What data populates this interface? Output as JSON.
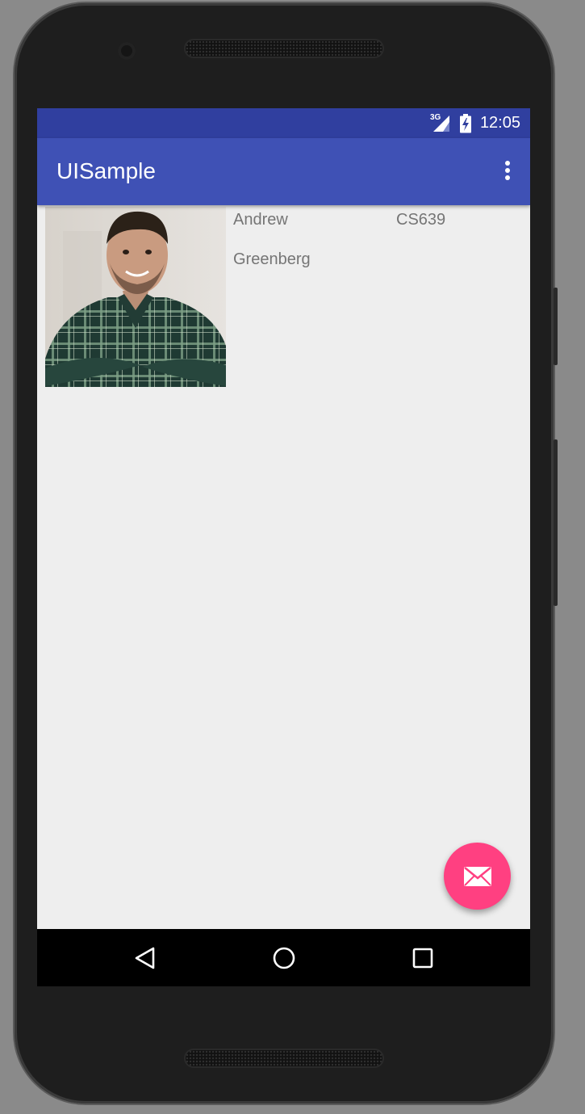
{
  "status_bar": {
    "network": "3G",
    "time": "12:05",
    "icons": [
      "signal-icon",
      "battery-charging-icon"
    ]
  },
  "app_bar": {
    "title": "UISample",
    "menu_icon": "more-vert-icon"
  },
  "profile": {
    "first_name": "Andrew",
    "last_name": "Greenberg",
    "course": "CS639",
    "photo": "profile-photo"
  },
  "fab": {
    "icon": "email-icon"
  },
  "nav_bar": {
    "icons": [
      "back-icon",
      "home-icon",
      "recents-icon"
    ]
  },
  "colors": {
    "primary": "#3f51b5",
    "primary_dark": "#303f9f",
    "accent": "#ff4081",
    "background": "#eeeeee",
    "text_secondary": "#757575"
  }
}
